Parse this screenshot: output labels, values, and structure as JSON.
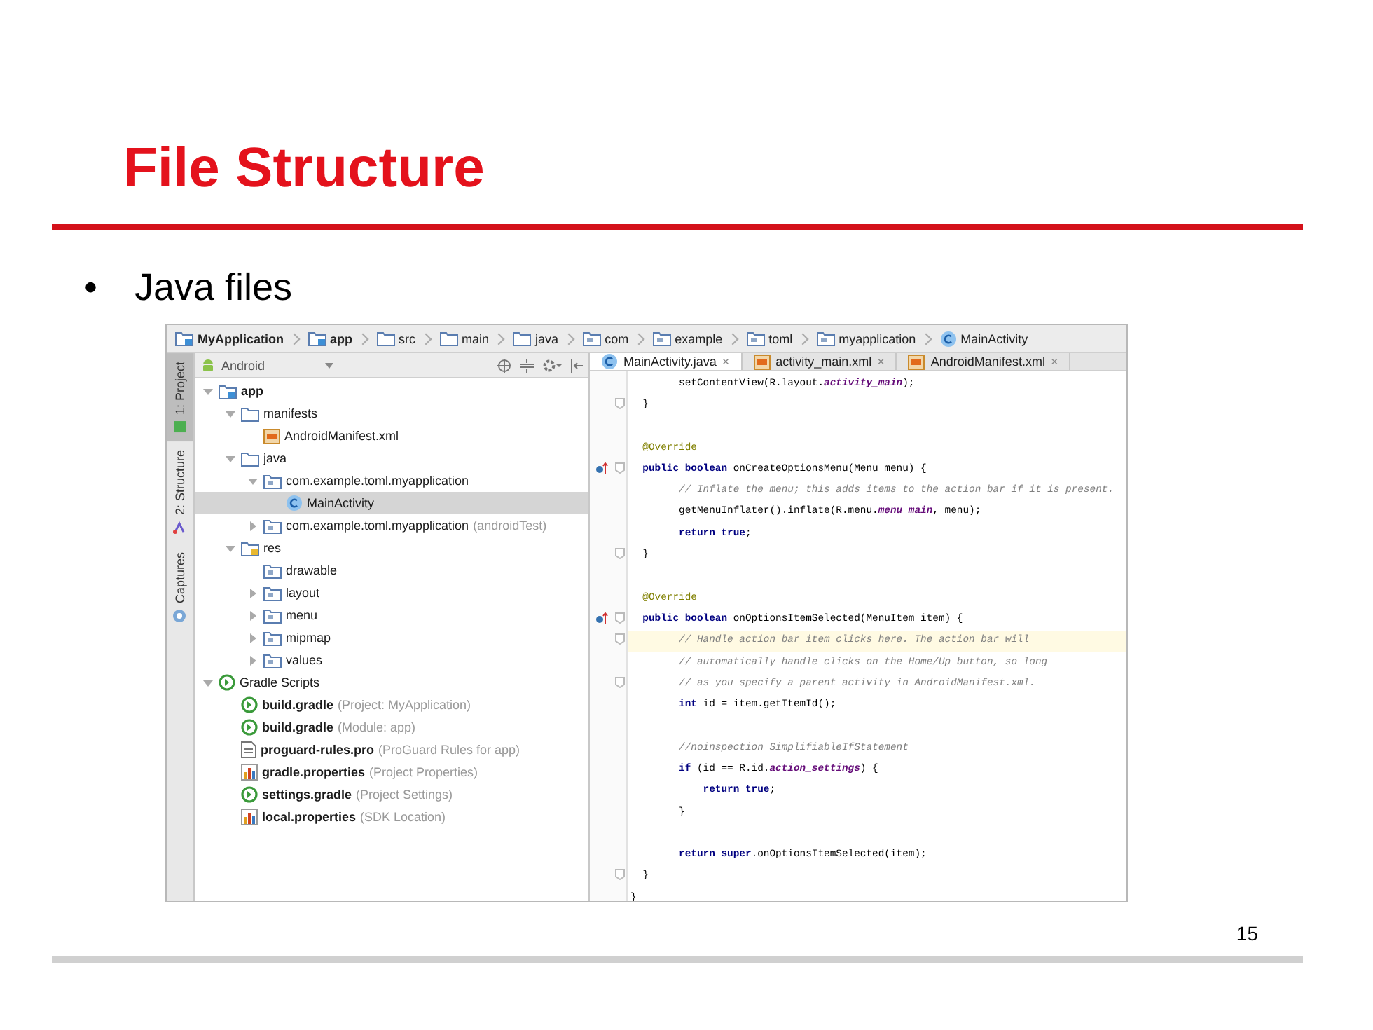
{
  "slide": {
    "title": "File Structure",
    "bullet": "•",
    "bullet_text": "Java files",
    "page_number": "15"
  },
  "breadcrumbs": [
    {
      "label": "MyApplication",
      "kind": "module",
      "bold": true
    },
    {
      "label": "app",
      "kind": "module",
      "bold": true
    },
    {
      "label": "src",
      "kind": "folder",
      "bold": false
    },
    {
      "label": "main",
      "kind": "folder",
      "bold": false
    },
    {
      "label": "java",
      "kind": "folder",
      "bold": false
    },
    {
      "label": "com",
      "kind": "package",
      "bold": false
    },
    {
      "label": "example",
      "kind": "package",
      "bold": false
    },
    {
      "label": "toml",
      "kind": "package",
      "bold": false
    },
    {
      "label": "myapplication",
      "kind": "package",
      "bold": false
    },
    {
      "label": "MainActivity",
      "kind": "class",
      "bold": false
    }
  ],
  "tool_windows": [
    {
      "label": "1: Project",
      "kind": "project",
      "selected": true
    },
    {
      "label": "2: Structure",
      "kind": "structure",
      "selected": false
    },
    {
      "label": "Captures",
      "kind": "captures",
      "selected": false
    }
  ],
  "view_dropdown": {
    "label": "Android"
  },
  "tabs": [
    {
      "label": "MainActivity.java",
      "kind": "class",
      "close": "×",
      "selected": true
    },
    {
      "label": "activity_main.xml",
      "kind": "xml",
      "close": "×",
      "selected": false
    },
    {
      "label": "AndroidManifest.xml",
      "kind": "xml",
      "close": "×",
      "selected": false
    }
  ],
  "tree": [
    {
      "name": "app",
      "kind": "module",
      "bold": true,
      "selected": false,
      "expanded": true,
      "children": [
        {
          "name": "manifests",
          "kind": "folder",
          "bold": false,
          "selected": false,
          "expanded": true,
          "children": [
            {
              "name": "AndroidManifest.xml",
              "kind": "xml",
              "bold": false,
              "selected": false
            }
          ]
        },
        {
          "name": "java",
          "kind": "folder",
          "bold": false,
          "selected": false,
          "expanded": true,
          "children": [
            {
              "name": "com.example.toml.myapplication",
              "kind": "package",
              "bold": false,
              "selected": false,
              "expanded": true,
              "children": [
                {
                  "name": "MainActivity",
                  "kind": "class",
                  "bold": false,
                  "selected": true
                }
              ]
            },
            {
              "name": "com.example.toml.myapplication",
              "hint": "(androidTest)",
              "kind": "package",
              "bold": false,
              "selected": false,
              "expanded": false
            }
          ]
        },
        {
          "name": "res",
          "kind": "res",
          "bold": false,
          "selected": false,
          "expanded": true,
          "children": [
            {
              "name": "drawable",
              "kind": "package",
              "bold": false,
              "selected": false
            },
            {
              "name": "layout",
              "kind": "package",
              "bold": false,
              "selected": false,
              "expanded": false
            },
            {
              "name": "menu",
              "kind": "package",
              "bold": false,
              "selected": false,
              "expanded": false
            },
            {
              "name": "mipmap",
              "kind": "package",
              "bold": false,
              "selected": false,
              "expanded": false
            },
            {
              "name": "values",
              "kind": "package",
              "bold": false,
              "selected": false,
              "expanded": false
            }
          ]
        }
      ]
    },
    {
      "name": "Gradle Scripts",
      "kind": "gradle",
      "bold": false,
      "selected": false,
      "expanded": true,
      "children": [
        {
          "name": "build.gradle",
          "hint": "(Project: MyApplication)",
          "kind": "gradle",
          "bold": true,
          "selected": false
        },
        {
          "name": "build.gradle",
          "hint": "(Module: app)",
          "kind": "gradle",
          "bold": true,
          "selected": false
        },
        {
          "name": "proguard-rules.pro",
          "hint": "(ProGuard Rules for app)",
          "kind": "file",
          "bold": true,
          "selected": false
        },
        {
          "name": "gradle.properties",
          "hint": "(Project Properties)",
          "kind": "properties",
          "bold": true,
          "selected": false
        },
        {
          "name": "settings.gradle",
          "hint": "(Project Settings)",
          "kind": "gradle",
          "bold": true,
          "selected": false
        },
        {
          "name": "local.properties",
          "hint": "(SDK Location)",
          "kind": "properties",
          "bold": true,
          "selected": false
        }
      ]
    }
  ],
  "code": [
    {
      "fold": false,
      "override": false,
      "current": false,
      "tokens": [
        {
          "kind": "plain",
          "text": "        setContentView(R.layout."
        },
        {
          "kind": "field",
          "text": "activity_main"
        },
        {
          "kind": "plain",
          "text": ");"
        }
      ]
    },
    {
      "fold": true,
      "override": false,
      "current": false,
      "tokens": [
        {
          "kind": "plain",
          "text": "  }"
        }
      ]
    },
    {
      "fold": false,
      "override": false
    },
    {
      "fold": false,
      "override": false,
      "current": false,
      "tokens": [
        {
          "kind": "annotation",
          "text": "  @Override"
        }
      ]
    },
    {
      "fold": true,
      "override": true,
      "current": false,
      "tokens": [
        {
          "kind": "keyword",
          "text": "  public boolean"
        },
        {
          "kind": "plain",
          "text": " onCreateOptionsMenu(Menu menu) {"
        }
      ]
    },
    {
      "fold": false,
      "override": false,
      "current": false,
      "tokens": [
        {
          "kind": "comment",
          "text": "        // Inflate the menu; this adds items to the action bar if it is present."
        }
      ]
    },
    {
      "fold": false,
      "override": false,
      "current": false,
      "tokens": [
        {
          "kind": "plain",
          "text": "        getMenuInflater().inflate(R.menu."
        },
        {
          "kind": "field",
          "text": "menu_main"
        },
        {
          "kind": "plain",
          "text": ", menu);"
        }
      ]
    },
    {
      "fold": false,
      "override": false,
      "current": false,
      "tokens": [
        {
          "kind": "keyword",
          "text": "        return true"
        },
        {
          "kind": "plain",
          "text": ";"
        }
      ]
    },
    {
      "fold": true,
      "override": false,
      "current": false,
      "tokens": [
        {
          "kind": "plain",
          "text": "  }"
        }
      ]
    },
    {
      "fold": false,
      "override": false
    },
    {
      "fold": false,
      "override": false,
      "current": false,
      "tokens": [
        {
          "kind": "annotation",
          "text": "  @Override"
        }
      ]
    },
    {
      "fold": true,
      "override": true,
      "current": false,
      "tokens": [
        {
          "kind": "keyword",
          "text": "  public boolean"
        },
        {
          "kind": "plain",
          "text": " onOptionsItemSelected(MenuItem item) {"
        }
      ]
    },
    {
      "fold": true,
      "override": false,
      "current": true,
      "tokens": [
        {
          "kind": "comment",
          "text": "        // Handle action bar item clicks here. The action bar will"
        }
      ]
    },
    {
      "fold": false,
      "override": false,
      "current": false,
      "tokens": [
        {
          "kind": "comment",
          "text": "        // automatically handle clicks on the Home/Up button, so long"
        }
      ]
    },
    {
      "fold": true,
      "override": false,
      "current": false,
      "tokens": [
        {
          "kind": "comment",
          "text": "        // as you specify a parent activity in AndroidManifest.xml."
        }
      ]
    },
    {
      "fold": false,
      "override": false,
      "current": false,
      "tokens": [
        {
          "kind": "keyword",
          "text": "        int"
        },
        {
          "kind": "plain",
          "text": " id = item.getItemId();"
        }
      ]
    },
    {
      "fold": false,
      "override": false
    },
    {
      "fold": false,
      "override": false,
      "current": false,
      "tokens": [
        {
          "kind": "comment",
          "text": "        //noinspection SimplifiableIfStatement"
        }
      ]
    },
    {
      "fold": false,
      "override": false,
      "current": false,
      "tokens": [
        {
          "kind": "keyword",
          "text": "        if"
        },
        {
          "kind": "plain",
          "text": " (id == R.id."
        },
        {
          "kind": "field",
          "text": "action_settings"
        },
        {
          "kind": "plain",
          "text": ") {"
        }
      ]
    },
    {
      "fold": false,
      "override": false,
      "current": false,
      "tokens": [
        {
          "kind": "keyword",
          "text": "            return true"
        },
        {
          "kind": "plain",
          "text": ";"
        }
      ]
    },
    {
      "fold": false,
      "override": false,
      "current": false,
      "tokens": [
        {
          "kind": "plain",
          "text": "        }"
        }
      ]
    },
    {
      "fold": false,
      "override": false
    },
    {
      "fold": false,
      "override": false,
      "current": false,
      "tokens": [
        {
          "kind": "keyword",
          "text": "        return super"
        },
        {
          "kind": "plain",
          "text": ".onOptionsItemSelected(item);"
        }
      ]
    },
    {
      "fold": true,
      "override": false,
      "current": false,
      "tokens": [
        {
          "kind": "plain",
          "text": "  }"
        }
      ]
    },
    {
      "fold": false,
      "override": false,
      "current": false,
      "tokens": [
        {
          "kind": "plain",
          "text": "}"
        }
      ]
    }
  ]
}
